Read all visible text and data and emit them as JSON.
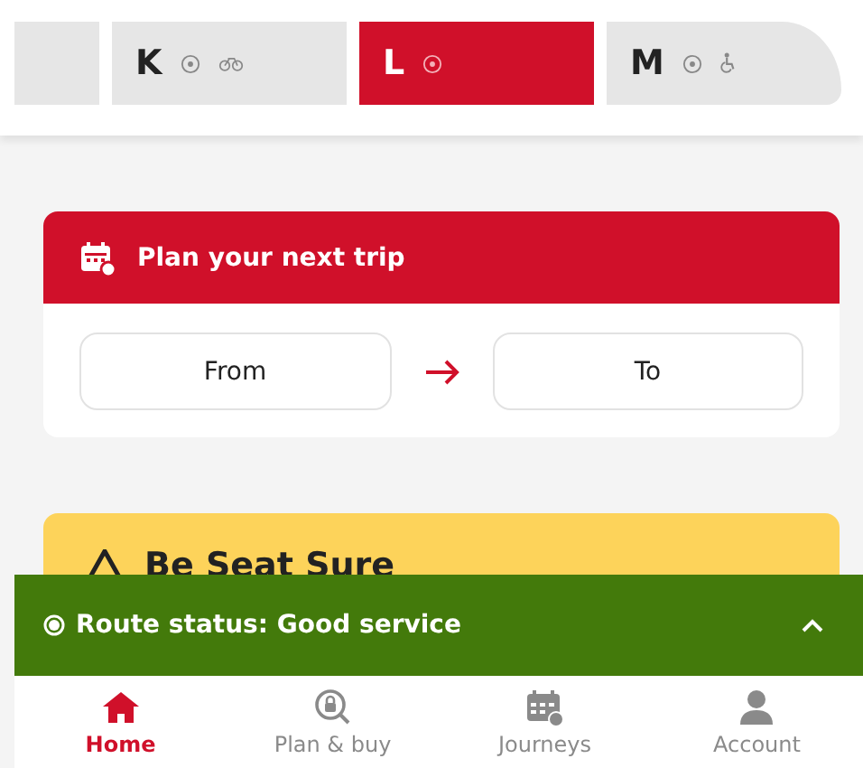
{
  "line_tabs": [
    {
      "letter": "K",
      "selected": false,
      "park_and_ride": true,
      "bike": true,
      "accessible": false
    },
    {
      "letter": "L",
      "selected": true,
      "park_and_ride": true,
      "bike": false,
      "accessible": false
    },
    {
      "letter": "M",
      "selected": false,
      "park_and_ride": true,
      "bike": false,
      "accessible": true
    }
  ],
  "trip_card": {
    "title": "Plan your next trip",
    "from": "From",
    "to": "To"
  },
  "notice": {
    "title": "Be Seat Sure"
  },
  "route_status": {
    "text": "Route status: Good service",
    "expanded": false
  },
  "nav": [
    {
      "kind": "home",
      "label": "Home",
      "selected": true
    },
    {
      "kind": "plan",
      "label": "Plan & buy",
      "selected": false
    },
    {
      "kind": "journeys",
      "label": "Journeys",
      "selected": false
    },
    {
      "kind": "account",
      "label": "Account",
      "selected": false
    }
  ]
}
